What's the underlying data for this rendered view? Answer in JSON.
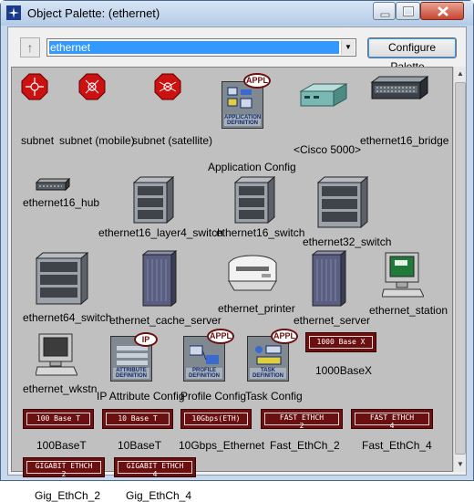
{
  "window": {
    "title": "Object Palette: (ethernet)"
  },
  "toolbar": {
    "up_icon": "up-arrow-icon",
    "palette_value": "ethernet",
    "configure_label": "Configure Palette..."
  },
  "items": {
    "subnet": "subnet",
    "subnet_mobile": "subnet (mobile)",
    "subnet_satellite": "subnet (satellite)",
    "app_config": "Application Config",
    "cisco": "<Cisco 5000>",
    "bridge": "ethernet16_bridge",
    "hub": "ethernet16_hub",
    "layer4": "ethernet16_layer4_switch",
    "sw16": "ethernet16_switch",
    "sw32": "ethernet32_switch",
    "sw64": "ethernet64_switch",
    "cache": "ethernet_cache_server",
    "printer": "ethernet_printer",
    "server": "ethernet_server",
    "station": "ethernet_station",
    "wkstn": "ethernet_wkstn",
    "ip_config": "IP Attribute Config",
    "profile_config": "Profile Config",
    "task_config": "Task Config",
    "base1000x": "1000BaseX",
    "base100t": "100BaseT",
    "base10t": "10BaseT",
    "gbps10": "10Gbps_Ethernet",
    "fast2": "Fast_EthCh_2",
    "fast4": "Fast_EthCh_4",
    "giga2": "Gig_EthCh_2",
    "giga4": "Gig_EthCh_4"
  },
  "icon_text": {
    "appl": "APPL",
    "ip": "IP",
    "app_def": "APPLICATION DEFINITION",
    "attr_def": "ATTRIBUTE DEFINITION",
    "profile_def": "PROFILE DEFINITION",
    "task_def": "TASK DEFINITION",
    "t1000x": "1000 Base X",
    "t100t": "100 Base T",
    "t10t": "10 Base T",
    "t10g": "10Gbps(ETH)",
    "fast": "FAST ETHCH",
    "gigabit": "GIGABIT ETHCH",
    "n2": "2",
    "n4": "4"
  },
  "colors": {
    "tag_red": "#6b1010",
    "subnet_red": "#cc1111",
    "selection": "#3399ff"
  }
}
